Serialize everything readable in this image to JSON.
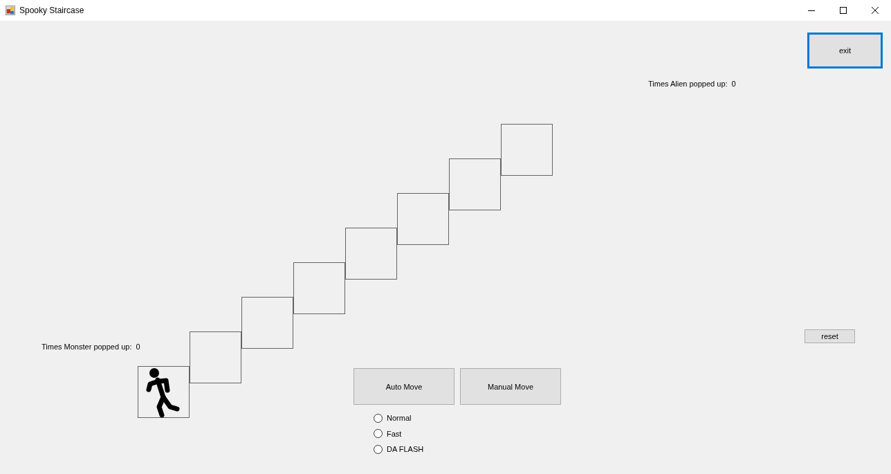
{
  "window": {
    "title": "Spooky Staircase"
  },
  "exit_button": {
    "label": "exit",
    "focused": true
  },
  "alien_counter": {
    "label": "Times Alien popped up:",
    "value": "0"
  },
  "staircase": {
    "steps": [
      {
        "has_runner": true
      },
      {
        "has_runner": false
      },
      {
        "has_runner": false
      },
      {
        "has_runner": false
      },
      {
        "has_runner": false
      },
      {
        "has_runner": false
      },
      {
        "has_runner": false
      },
      {
        "has_runner": false
      }
    ]
  },
  "monster_counter": {
    "label": "Times Monster popped up:",
    "value": "0"
  },
  "reset_button": {
    "label": "reset"
  },
  "move_buttons": [
    {
      "label": "Auto Move"
    },
    {
      "label": "Manual Move"
    }
  ],
  "speed_options": [
    {
      "label": "Normal",
      "selected": false
    },
    {
      "label": "Fast",
      "selected": false
    },
    {
      "label": "DA FLASH",
      "selected": false
    }
  ]
}
